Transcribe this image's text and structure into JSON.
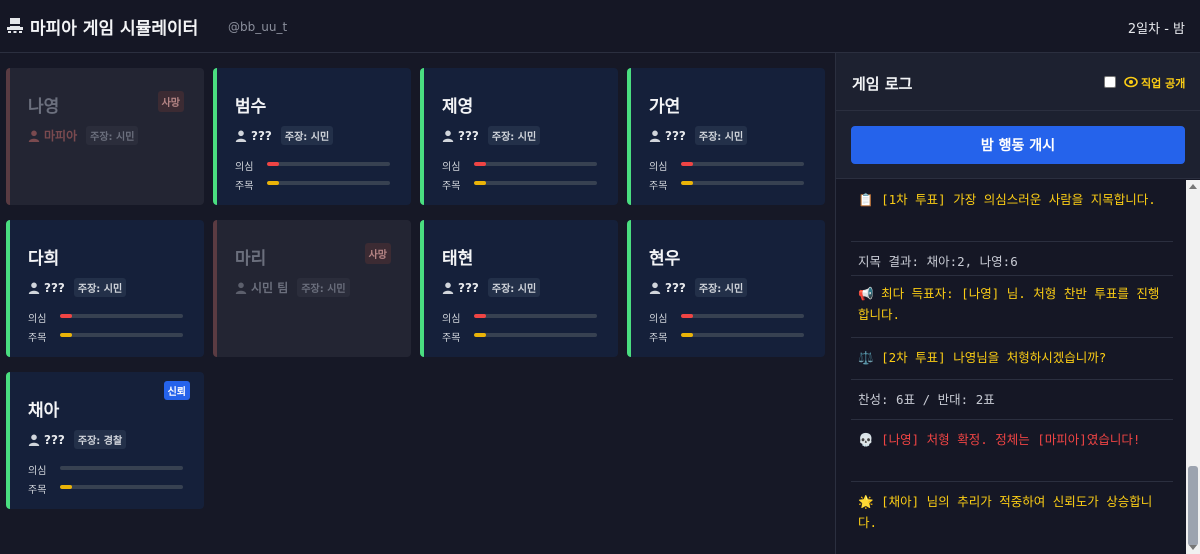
{
  "header": {
    "title": "마피아 게임 시뮬레이터",
    "handle": "@bb_uu_t",
    "day_status": "2일차 - 밤"
  },
  "labels": {
    "suspicion": "의심",
    "attention": "주목"
  },
  "players": [
    {
      "name": "나영",
      "role": "마피아",
      "claim": "주장: 시민",
      "dead": true,
      "badge": "사망",
      "suspicion": 0,
      "attention": 0
    },
    {
      "name": "범수",
      "role": "???",
      "claim": "주장: 시민",
      "dead": false,
      "suspicion": 0.1,
      "attention": 0.1
    },
    {
      "name": "제영",
      "role": "???",
      "claim": "주장: 시민",
      "dead": false,
      "suspicion": 0.1,
      "attention": 0.1
    },
    {
      "name": "가연",
      "role": "???",
      "claim": "주장: 시민",
      "dead": false,
      "suspicion": 0.1,
      "attention": 0.1
    },
    {
      "name": "다희",
      "role": "???",
      "claim": "주장: 시민",
      "dead": false,
      "suspicion": 0.1,
      "attention": 0.1
    },
    {
      "name": "마리",
      "role": "시민 팀",
      "claim": "주장: 시민",
      "dead": true,
      "badge": "사망",
      "suspicion": 0,
      "attention": 0
    },
    {
      "name": "태현",
      "role": "???",
      "claim": "주장: 시민",
      "dead": false,
      "suspicion": 0.1,
      "attention": 0.1
    },
    {
      "name": "현우",
      "role": "???",
      "claim": "주장: 시민",
      "dead": false,
      "suspicion": 0.1,
      "attention": 0.1
    },
    {
      "name": "채아",
      "role": "???",
      "claim": "주장: 경찰",
      "dead": false,
      "badge": "신뢰",
      "suspicion": 0,
      "attention": 0.1
    }
  ],
  "log": {
    "title": "게임 로그",
    "reveal_label": "직업 공개",
    "reveal_checked": false,
    "night_button": "밤 행동 개시",
    "entries": [
      {
        "text": "📋 [1차 투표] 가장 의심스러운 사람을 지목합니다.",
        "color": "#facc15"
      },
      {
        "text": "지목 결과: 채아:2, 나영:6",
        "color": "#c7cad3"
      },
      {
        "text": "📢 최다 득표자: [나영] 님. 처형 찬반 투표를 진행합니다.",
        "color": "#facc15"
      },
      {
        "text": "⚖️ [2차 투표] 나영님을 처형하시겠습니까?",
        "color": "#facc15"
      },
      {
        "text": "찬성: 6표 / 반대: 2표",
        "color": "#c7cad3"
      },
      {
        "text": "💀 [나영] 처형 확정. 정체는 [마피아]였습니다!",
        "color": "#ef4444"
      },
      {
        "text": "🌟 [채아] 님의 추리가 적중하여 신뢰도가 상승합니다.",
        "color": "#facc15"
      }
    ]
  }
}
